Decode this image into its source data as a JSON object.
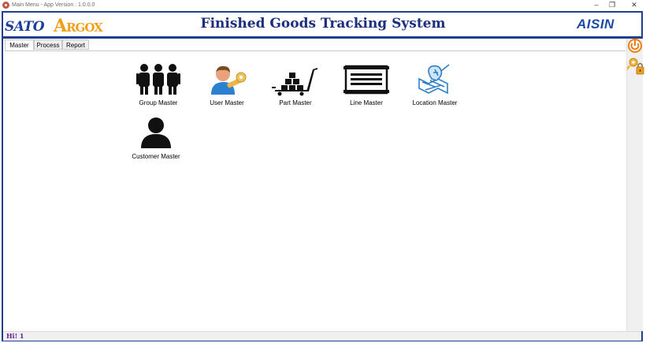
{
  "window": {
    "title": "Main Menu - App Version : 1.0.0.0",
    "minimize": "–",
    "restore": "❐",
    "close": "✕"
  },
  "banner": {
    "logo_left_a": "SATO",
    "logo_left_b_initial": "A",
    "logo_left_b_rest": "RGOX",
    "title": "Finished Goods Tracking System",
    "logo_right": "AISIN"
  },
  "tabs": [
    {
      "label": "Master",
      "active": true
    },
    {
      "label": "Process",
      "active": false
    },
    {
      "label": "Report",
      "active": false
    }
  ],
  "tiles": [
    {
      "label": "Group Master",
      "icon": "group-icon"
    },
    {
      "label": "User Master",
      "icon": "user-key-icon"
    },
    {
      "label": "Part Master",
      "icon": "hand-truck-icon"
    },
    {
      "label": "Line Master",
      "icon": "conveyor-icon"
    },
    {
      "label": "Location Master",
      "icon": "map-pin-icon"
    },
    {
      "label": "Customer Master",
      "icon": "customer-icon"
    }
  ],
  "sidebar": {
    "power_icon": "power-icon",
    "key_lock_icon": "key-lock-icon"
  },
  "status": {
    "greeting": "Hi! 1"
  },
  "colors": {
    "brand_blue": "#1f3f8f",
    "argox_orange": "#f0a017",
    "greeting_purple": "#6a1b8f"
  }
}
